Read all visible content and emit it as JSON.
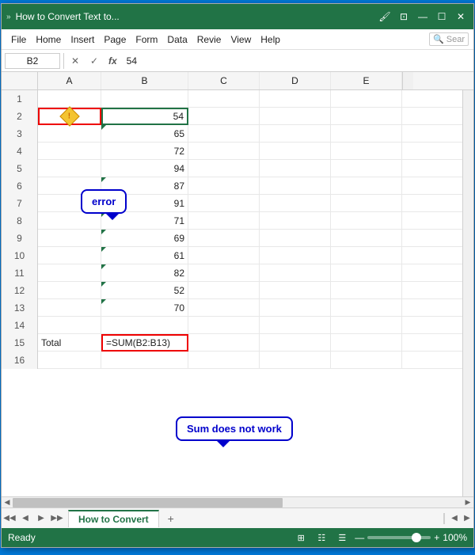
{
  "window": {
    "title": "How to Convert Text to...",
    "dots": "»"
  },
  "titlebar": {
    "brush_icon": "🖌",
    "restore_icon": "⊡",
    "minimize_icon": "—",
    "maximize_icon": "☐",
    "close_icon": "✕"
  },
  "menu": {
    "items": [
      "File",
      "Home",
      "Insert",
      "Page",
      "Form",
      "Data",
      "Revie",
      "View",
      "Help"
    ],
    "search_placeholder": "Sear",
    "search_icon": "🔍"
  },
  "formula_bar": {
    "cell_ref": "B2",
    "cancel_icon": "✕",
    "confirm_icon": "✓",
    "fx_label": "fx",
    "formula_value": "54"
  },
  "columns": {
    "corner": "",
    "headers": [
      "A",
      "B",
      "C",
      "D",
      "E"
    ]
  },
  "rows": [
    {
      "num": "1",
      "a": "",
      "b": "",
      "c": "",
      "d": "",
      "e": ""
    },
    {
      "num": "2",
      "a": "ERROR_ICON",
      "b": "54",
      "c": "",
      "d": "",
      "e": "",
      "b_selected": true,
      "a_error": true
    },
    {
      "num": "3",
      "a": "",
      "b": "65",
      "c": "",
      "d": "",
      "e": ""
    },
    {
      "num": "4",
      "a": "",
      "b": "72",
      "c": "",
      "d": "",
      "e": ""
    },
    {
      "num": "5",
      "a": "",
      "b": "94",
      "c": "",
      "d": "",
      "e": ""
    },
    {
      "num": "6",
      "a": "",
      "b": "87",
      "c": "",
      "d": "",
      "e": ""
    },
    {
      "num": "7",
      "a": "",
      "b": "91",
      "c": "",
      "d": "",
      "e": ""
    },
    {
      "num": "8",
      "a": "",
      "b": "71",
      "c": "",
      "d": "",
      "e": ""
    },
    {
      "num": "9",
      "a": "",
      "b": "69",
      "c": "",
      "d": "",
      "e": ""
    },
    {
      "num": "10",
      "a": "",
      "b": "61",
      "c": "",
      "d": "",
      "e": ""
    },
    {
      "num": "11",
      "a": "",
      "b": "82",
      "c": "",
      "d": "",
      "e": ""
    },
    {
      "num": "12",
      "a": "",
      "b": "52",
      "c": "",
      "d": "",
      "e": ""
    },
    {
      "num": "13",
      "a": "",
      "b": "70",
      "c": "",
      "d": "",
      "e": ""
    },
    {
      "num": "14",
      "a": "",
      "b": "",
      "c": "",
      "d": "",
      "e": ""
    },
    {
      "num": "15",
      "a": "Total",
      "b": "=SUM(B2:B13)",
      "c": "",
      "d": "",
      "e": "",
      "b_sum": true
    },
    {
      "num": "16",
      "a": "",
      "b": "",
      "c": "",
      "d": "",
      "e": ""
    }
  ],
  "callouts": {
    "error_label": "error",
    "sum_label": "Sum does not work"
  },
  "sheet_tab": {
    "name": "How to Convert",
    "plus": "+"
  },
  "status": {
    "ready": "Ready",
    "zoom": "100%",
    "zoom_minus": "—",
    "zoom_plus": "+",
    "view_normal": "⊞",
    "view_layout": "☷",
    "view_page": "☰"
  }
}
